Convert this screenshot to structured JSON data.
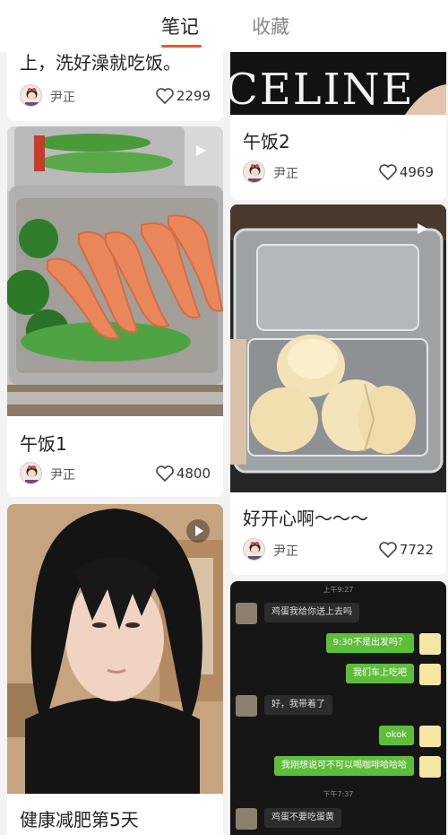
{
  "tabs": {
    "notes": "笔记",
    "favorites": "收藏"
  },
  "colors": {
    "accent": "#e8563c",
    "like_icon": "#444444",
    "chat_bg": "#161616",
    "chat_green": "#5fbd3c"
  },
  "cards": [
    {
      "title": "上，洗好澡就吃饭。",
      "author": "尹正",
      "likes": "2299"
    },
    {
      "title": "午饭2",
      "author": "尹正",
      "likes": "4969"
    },
    {
      "title": "午饭1",
      "author": "尹正",
      "likes": "4800",
      "is_video": true
    },
    {
      "title": "好开心啊～～～",
      "author": "尹正",
      "likes": "7722",
      "is_video": true
    },
    {
      "title": "健康减肥第5天",
      "author": "",
      "likes": "",
      "is_video": true
    },
    {
      "title": "",
      "author": "",
      "likes": ""
    }
  ],
  "chat": {
    "times": [
      "上午9:27",
      "下午7:37"
    ],
    "messages": [
      {
        "side": "left",
        "text": "鸡蛋我给你送上去吗"
      },
      {
        "side": "right",
        "text": "9:30不是出发吗？"
      },
      {
        "side": "right",
        "text": "我们车上吃吧"
      },
      {
        "side": "left",
        "text": "好，我带着了"
      },
      {
        "side": "right",
        "text": "okok"
      },
      {
        "side": "right",
        "text": "我刚想说可不可以喝咖啡哈哈哈"
      },
      {
        "side": "left",
        "text": "鸡蛋不要吃蛋黄"
      }
    ]
  },
  "images": {
    "shirt_text": "CELINE"
  }
}
